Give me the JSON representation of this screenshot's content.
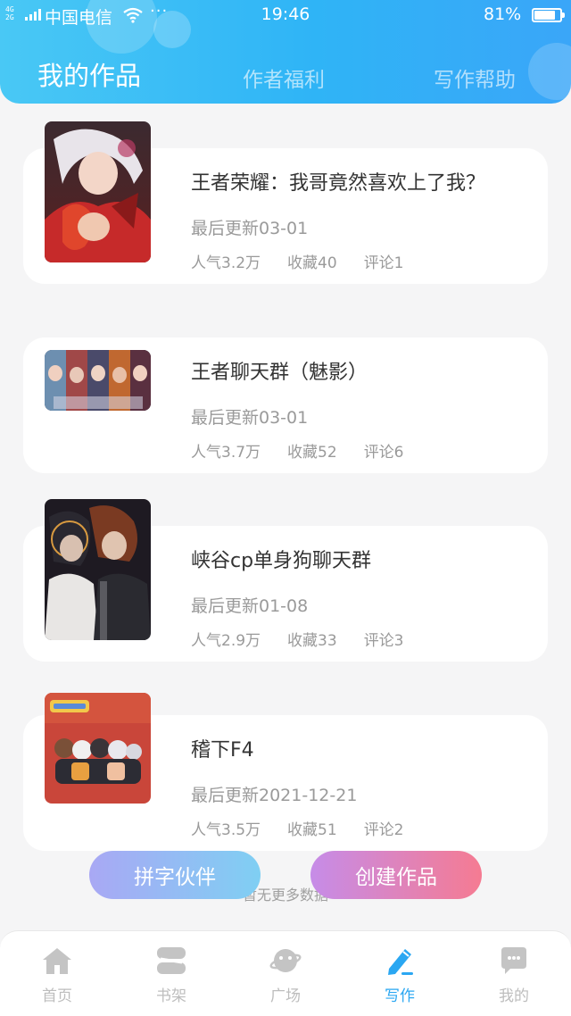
{
  "status_bar": {
    "network_tag": "4G\n2G",
    "carrier": "中国电信",
    "more": "···",
    "time": "19:46",
    "battery_percent": "81%",
    "battery_level": 0.81
  },
  "header": {
    "tabs": [
      {
        "label": "我的作品",
        "active": true
      },
      {
        "label": "作者福利",
        "active": false
      },
      {
        "label": "写作帮助",
        "active": false
      }
    ]
  },
  "works": [
    {
      "title": "王者荣耀：我哥竟然喜欢上了我？",
      "updated": "最后更新03-01",
      "popularity": "人气3.2万",
      "favorites": "收藏40",
      "comments": "评论1"
    },
    {
      "title": "王者聊天群（魅影）",
      "updated": "最后更新03-01",
      "popularity": "人气3.7万",
      "favorites": "收藏52",
      "comments": "评论6"
    },
    {
      "title": "峡谷cp单身狗聊天群",
      "updated": "最后更新01-08",
      "popularity": "人气2.9万",
      "favorites": "收藏33",
      "comments": "评论3"
    },
    {
      "title": "稽下F4",
      "updated": "最后更新2021-12-21",
      "popularity": "人气3.5万",
      "favorites": "收藏51",
      "comments": "评论2"
    }
  ],
  "footer": {
    "no_more_text": "暂无更多数据",
    "partner_button": "拼字伙伴",
    "create_button": "创建作品"
  },
  "bottom_nav": [
    {
      "label": "首页",
      "icon": "home-icon",
      "active": false
    },
    {
      "label": "书架",
      "icon": "bookshelf-icon",
      "active": false
    },
    {
      "label": "广场",
      "icon": "planet-icon",
      "active": false
    },
    {
      "label": "写作",
      "icon": "pen-icon",
      "active": true
    },
    {
      "label": "我的",
      "icon": "chat-bubble-icon",
      "active": false
    }
  ],
  "colors": {
    "header_start": "#49c8f5",
    "header_end": "#3aa6f8",
    "active_nav": "#2aa7f2",
    "inactive_nav": "#bdbdbd"
  }
}
